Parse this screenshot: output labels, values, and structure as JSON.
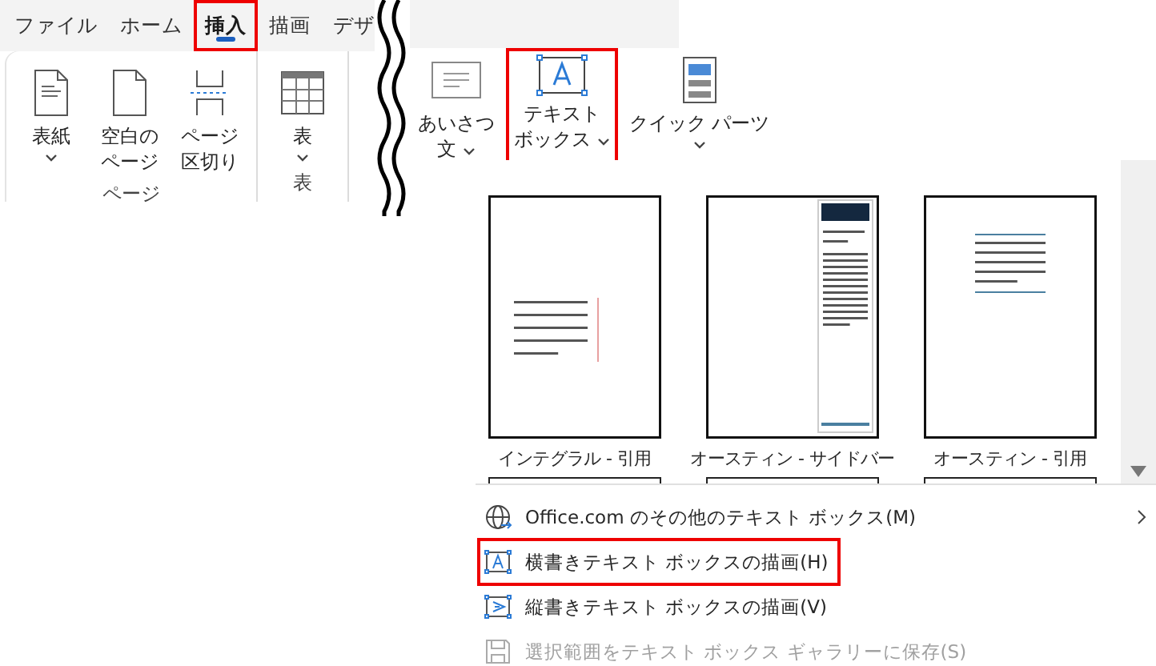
{
  "tabs": [
    {
      "label": "ファイル",
      "selected": false,
      "highlighted": false
    },
    {
      "label": "ホーム",
      "selected": false,
      "highlighted": false
    },
    {
      "label": "挿入",
      "selected": true,
      "highlighted": true
    },
    {
      "label": "描画",
      "selected": false,
      "highlighted": false
    },
    {
      "label": "デザ",
      "selected": false,
      "highlighted": false
    }
  ],
  "ribbon_groups": [
    {
      "label": "ページ",
      "buttons": [
        {
          "lines": [
            "表紙"
          ],
          "dropdown": true,
          "highlighted": false
        },
        {
          "lines": [
            "空白の",
            "ページ"
          ],
          "dropdown": false,
          "highlighted": false
        },
        {
          "lines": [
            "ページ",
            "区切り"
          ],
          "dropdown": false,
          "highlighted": false
        }
      ]
    },
    {
      "label": "表",
      "buttons": [
        {
          "lines": [
            "表"
          ],
          "dropdown": true,
          "highlighted": false
        }
      ]
    }
  ],
  "ribbon_right_buttons": [
    {
      "lines": [
        "あいさつ",
        "文"
      ],
      "dropdown": true,
      "highlighted": false
    },
    {
      "lines": [
        "テキスト",
        "ボックス"
      ],
      "dropdown": true,
      "highlighted": true
    },
    {
      "lines": [
        "クイック パーツ"
      ],
      "dropdown": true,
      "highlighted": false
    }
  ],
  "gallery": [
    {
      "label": "インテグラル - 引用",
      "kind": "side-quote"
    },
    {
      "label": "オースティン - サイドバー",
      "kind": "sidebar"
    },
    {
      "label": "オースティン - 引用",
      "kind": "top-quote"
    }
  ],
  "menu": [
    {
      "label": "Office.com のその他のテキスト ボックス(M)",
      "submenu": true,
      "highlighted": false,
      "disabled": false
    },
    {
      "label": "横書きテキスト ボックスの描画(H)",
      "submenu": false,
      "highlighted": true,
      "disabled": false
    },
    {
      "label": "縦書きテキスト ボックスの描画(V)",
      "submenu": false,
      "highlighted": false,
      "disabled": false
    },
    {
      "label": "選択範囲をテキスト ボックス ギャラリーに保存(S)",
      "submenu": false,
      "highlighted": false,
      "disabled": true
    }
  ]
}
